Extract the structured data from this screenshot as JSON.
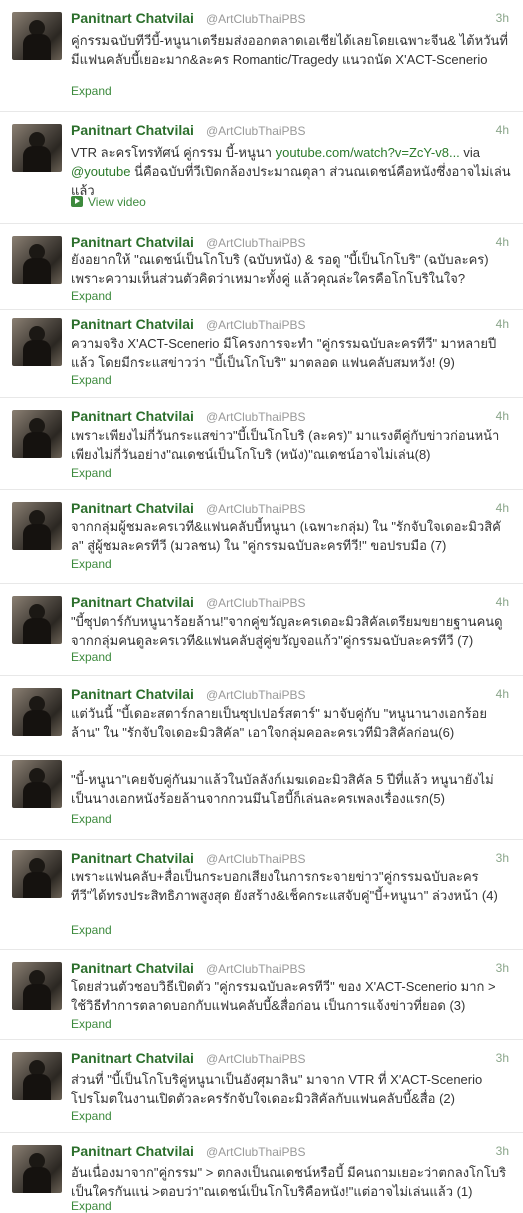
{
  "tweets": [
    {
      "name": "Panitnart Chatvilai",
      "handle": "@ArtClubThaiPBS",
      "time": "3h",
      "text": "คู่กรรมฉบับทีวีบี้-หนูนาเตรียมส่งออกตลาดเอเชียได้เลยโดยเฉพาะจีน& ไต้หวันที่มีแฟนคลับบี้เยอะมาก&ละคร Romantic/Tragedy แนวถนัด X'ACT-Scenerio",
      "action": "Expand"
    },
    {
      "name": "Panitnart Chatvilai",
      "handle": "@ArtClubThaiPBS",
      "time": "4h",
      "text_before": "VTR ละครโทรทัศน์ คู่กรรม บี้-หนูนา ",
      "link1": "youtube.com/watch?v=ZcY-v8...",
      "text_mid": " via ",
      "link2": "@youtube",
      "text_after": " นี่คือฉบับที่วีเปิดกล้องประมาณตุลา ส่วนณเดชน์คือหนังซึ่งอาจไม่เล่นแล้ว",
      "action": "View video"
    },
    {
      "name": "Panitnart Chatvilai",
      "handle": "@ArtClubThaiPBS",
      "time": "4h",
      "text": "ยังอยากให้ \"ณเดชน์เป็นโกโบริ (ฉบับหนัง) & รอดู \"บี้เป็นโกโบริ\" (ฉบับละคร) เพราะความเห็นส่วนตัวคิดว่าเหมาะทั้งคู่ แล้วคุณล่ะใครคือโกโบริในใจ?",
      "action": "Expand"
    },
    {
      "name": "Panitnart Chatvilai",
      "handle": "@ArtClubThaiPBS",
      "time": "4h",
      "text": "ความจริง X'ACT-Scenerio มีโครงการจะทำ \"คู่กรรมฉบับละครทีวี\" มาหลายปีแล้ว โดยมีกระแสข่าวว่า \"บี้เป็นโกโบริ\" มาตลอด แฟนคลับสมหวัง! (9)",
      "action": "Expand"
    },
    {
      "name": "Panitnart Chatvilai",
      "handle": "@ArtClubThaiPBS",
      "time": "4h",
      "text": "เพราะเพียงไม่กี่วันกระแสข่าว\"บี้เป็นโกโบริ (ละคร)\" มาแรงตีคู่กับข่าวก่อนหน้าเพียงไม่กี่วันอย่าง\"ณเดชน์เป็นโกโบริ (หนัง)\"ณเดชน์อาจไม่เล่น(8)",
      "action": "Expand"
    },
    {
      "name": "Panitnart Chatvilai",
      "handle": "@ArtClubThaiPBS",
      "time": "4h",
      "text": "จากกลุ่มผู้ชมละครเวที&แฟนคลับบี้หนูนา (เฉพาะกลุ่ม) ใน \"รักจับใจเดอะมิวสิคัล\" สู่ผู้ชมละครทีวี (มวลชน) ใน \"คู่กรรมฉบับละครทีวี!\" ขอปรบมือ (7)",
      "action": "Expand"
    },
    {
      "name": "Panitnart Chatvilai",
      "handle": "@ArtClubThaiPBS",
      "time": "4h",
      "text": "\"บี้ซุปตาร์กับหนูนาร้อยล้าน!\"จากคู่ขวัญละครเดอะมิวสิคัลเตรียมขยายฐานคนดูจากกลุ่มคนดูละครเวที&แฟนคลับสู่คู่ขวัญจอแก้ว\"คู่กรรมฉบับละครทีวี (7)",
      "action": "Expand"
    },
    {
      "name": "Panitnart Chatvilai",
      "handle": "@ArtClubThaiPBS",
      "time": "4h",
      "text": "แต่วันนี้ \"บี้เดอะสตาร์กลายเป็นซุปเปอร์สตาร์\" มาจับคู่กับ \"หนูนานางเอกร้อยล้าน\" ใน \"รักจับใจเดอะมิวสิคัล\" เอาใจกลุ่มคอละครเวทีมิวสิคัลก่อน(6)",
      "action": "Expand"
    },
    {
      "name": "",
      "handle": "",
      "time": "",
      "text": "\"บี้-หนูนา\"เคยจับคู่กันมาแล้วในบัลลังก์เมฆเดอะมิวสิคัล 5 ปีที่แล้ว หนูนายังไม่เป็นนางเอกหนังร้อยล้านจากกวนมึนโฮบี้ก็เล่นละครเพลงเรื่องแรก(5)",
      "action": "Expand"
    },
    {
      "name": "Panitnart Chatvilai",
      "handle": "@ArtClubThaiPBS",
      "time": "3h",
      "text": "เพราะแฟนคลับ+สื่อเป็นกระบอกเสียงในการกระจายข่าว\"คู่กรรมฉบับละครทีวี\"ได้ทรงประสิทธิภาพสูงสุด ยังสร้าง&เช็คกระแสจับคู่\"บี้+หนูนา\" ล่วงหน้า (4)",
      "action": "Expand"
    },
    {
      "name": "Panitnart Chatvilai",
      "handle": "@ArtClubThaiPBS",
      "time": "3h",
      "text": "โดยส่วนตัวชอบวิธีเปิดตัว \"คู่กรรมฉบับละครทีวี\" ของ X'ACT-Scenerio มาก > ใช้วิธีทำการตลาดบอกกับแฟนคลับบี้&สื่อก่อน เป็นการแจ้งข่าวที่ยอด (3)",
      "action": "Expand"
    },
    {
      "name": "Panitnart Chatvilai",
      "handle": "@ArtClubThaiPBS",
      "time": "3h",
      "text": "ส่วนที่ \"บี้เป็นโกโบริคู่หนูนาเป็นอังศุมาลิน\" มาจาก VTR ที่ X'ACT-Scenerio โปรโมตในงานเปิดตัวละครรักจับใจเดอะมิวสิคัลกับแฟนคลับบี้&สื่อ (2)",
      "action": "Expand"
    },
    {
      "name": "Panitnart Chatvilai",
      "handle": "@ArtClubThaiPBS",
      "time": "3h",
      "text": "อันเนื่องมาจาก\"คู่กรรม\" > ตกลงเป็นณเดชน์หรือบี้ มีคนถามเยอะว่าตกลงโกโบริเป็นใครกันแน่ >ตอบว่า\"ณเดชน์เป็นโกโบริคือหนัง!\"แต่อาจไม่เล่นแล้ว (1)",
      "action": "Expand"
    }
  ]
}
